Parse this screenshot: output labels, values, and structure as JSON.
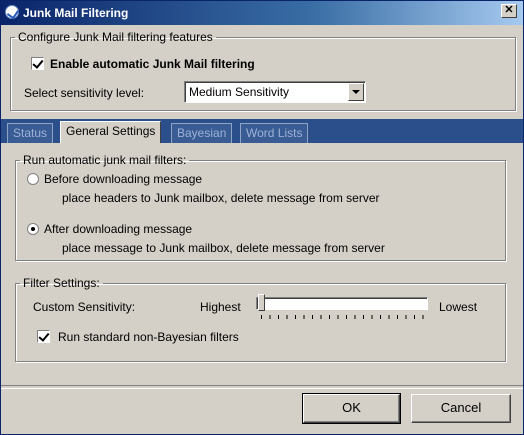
{
  "window": {
    "title": "Junk Mail Filtering",
    "close_label": "✕"
  },
  "top_group": {
    "legend": "Configure Junk Mail filtering features",
    "enable_label": "Enable automatic Junk Mail filtering",
    "enable_checked": true,
    "sensitivity_label": "Select sensitivity level:",
    "sensitivity_value": "Medium Sensitivity"
  },
  "tabs": [
    {
      "label": "Status",
      "active": false
    },
    {
      "label": "General Settings",
      "active": true
    },
    {
      "label": "Bayesian",
      "active": false
    },
    {
      "label": "Word Lists",
      "active": false
    }
  ],
  "run_group": {
    "legend": "Run automatic junk mail filters:",
    "before_label": "Before downloading message",
    "before_desc": "place headers to Junk mailbox, delete message from server",
    "after_label": "After downloading message",
    "after_desc": "place message to Junk mailbox, delete message from server",
    "selected": "after"
  },
  "filter_group": {
    "legend": "Filter Settings:",
    "custom_label": "Custom Sensitivity:",
    "highest_label": "Highest",
    "lowest_label": "Lowest",
    "slider_value": 0,
    "nonbayes_label": "Run standard non-Bayesian filters",
    "nonbayes_checked": true
  },
  "buttons": {
    "ok": "OK",
    "cancel": "Cancel"
  }
}
